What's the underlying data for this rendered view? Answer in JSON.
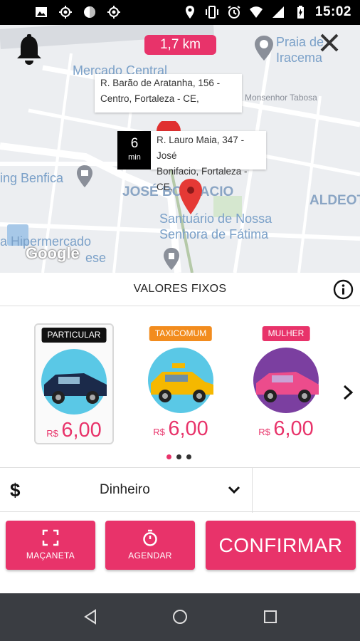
{
  "status_bar": {
    "time": "15:02",
    "left_icons": [
      "image-icon",
      "crosshair-icon",
      "circle-icon",
      "crosshair-icon"
    ],
    "right_icons": [
      "location-icon",
      "vibrate-icon",
      "alarm-icon",
      "wifi-icon",
      "signal-icon",
      "battery-charging-icon"
    ]
  },
  "map": {
    "distance": "1,7 km",
    "labels": {
      "mercado": "Mercado Central",
      "praia_1": "Praia de",
      "praia_2": "Iracema",
      "benfica": "ing Benfica",
      "jose": "JOSÉ BONFACIO",
      "aldeota": "ALDEOT",
      "santuario_1": "Santuário de Nossa",
      "santuario_2": "Senhora de Fátima",
      "hiper": "a Hipermercado",
      "ese": "ese",
      "tabosa": "Monsenhor Tabosa",
      "google": "Google"
    },
    "origin_address": {
      "line1": "R. Barão de Aratanha, 156 -",
      "line2": "Centro, Fortaleza - CE,"
    },
    "destination_address": {
      "line1": "R. Lauro Maia, 347 - José",
      "line2": "Bonifacio, Fortaleza - CE,"
    },
    "eta": {
      "value": "6",
      "unit": "min"
    }
  },
  "fixed_values": {
    "title": "VALORES FIXOS"
  },
  "vehicles": [
    {
      "tag": "PARTICULAR",
      "currency": "R$",
      "price": "6,00",
      "tag_color": "#111111",
      "car_color": "#1b2a4a",
      "bg_color": "#5ac8e6",
      "selected": true
    },
    {
      "tag": "TAXICOMUM",
      "currency": "R$",
      "price": "6,00",
      "tag_color": "#f28c1e",
      "car_color": "#f5b800",
      "bg_color": "#5ac8e6",
      "selected": false
    },
    {
      "tag": "MULHER",
      "currency": "R$",
      "price": "6,00",
      "tag_color": "#e8336a",
      "car_color": "#ec4c8c",
      "bg_color": "#7b3fa0",
      "selected": false
    }
  ],
  "pager": {
    "total": 3,
    "active": 0
  },
  "payment": {
    "icon": "$",
    "method": "Dinheiro"
  },
  "actions": {
    "macaneta": "MAÇANETA",
    "agendar": "AGENDAR",
    "confirmar": "CONFIRMAR"
  },
  "colors": {
    "accent": "#e8336a",
    "nav_bar": "#3a3d42"
  }
}
